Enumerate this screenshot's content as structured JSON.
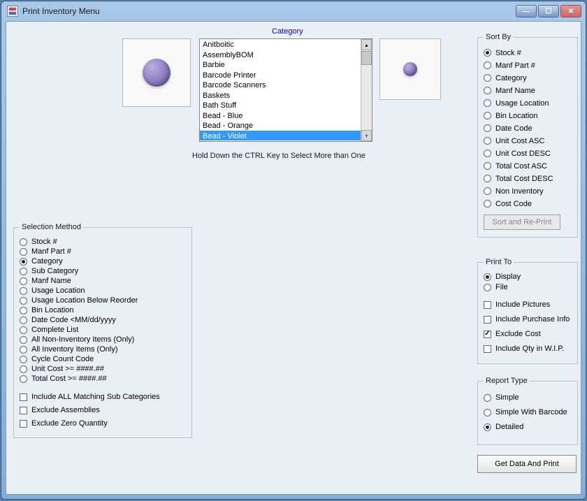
{
  "window": {
    "title": "Print Inventory Menu"
  },
  "category": {
    "label": "Category",
    "hint": "Hold Down the CTRL Key to Select More than One",
    "items": [
      "Anitboitic",
      "AssemblyBOM",
      "Barbie",
      "Barcode Printer",
      "Barcode Scanners",
      "Baskets",
      "Bath Stuff",
      "Bead - Blue",
      "Bead - Orange",
      "Bead - Violet"
    ],
    "selected_index": 9
  },
  "selection_method": {
    "legend": "Selection Method",
    "options": [
      "Stock #",
      "Manf Part #",
      "Category",
      "Sub Category",
      "Manf Name",
      "Usage Location",
      "Usage Location Below Reorder",
      "Bin Location",
      "Date Code <MM/dd/yyyy",
      "Complete List",
      "All Non-Inventory Items (Only)",
      "All Inventory Items (Only)",
      "Cycle Count Code",
      "Unit Cost   >= ####.##",
      "Total Cost >= ####.##"
    ],
    "selected_index": 2,
    "checks": [
      {
        "label": "Include ALL Matching Sub Categories",
        "checked": false
      },
      {
        "label": "Exclude Assemblies",
        "checked": false
      },
      {
        "label": "Exclude Zero Quantity",
        "checked": false
      }
    ]
  },
  "sort_by": {
    "legend": "Sort By",
    "options": [
      "Stock #",
      "Manf Part #",
      "Category",
      "Manf Name",
      "Usage Location",
      "Bin Location",
      "Date Code",
      "Unit Cost ASC",
      "Unit Cost DESC",
      "Total Cost ASC",
      "Total Cost DESC",
      "Non Inventory",
      "Cost Code"
    ],
    "selected_index": 0,
    "button": "Sort and Re-Print"
  },
  "print_to": {
    "legend": "Print To",
    "options": [
      "Display",
      "File"
    ],
    "selected_index": 0,
    "checks": [
      {
        "label": "Include Pictures",
        "checked": false
      },
      {
        "label": "Include Purchase Info",
        "checked": false
      },
      {
        "label": "Exclude Cost",
        "checked": true
      },
      {
        "label": "Include Qty in W.I.P.",
        "checked": false
      }
    ]
  },
  "report_type": {
    "legend": "Report Type",
    "options": [
      "Simple",
      "Simple With Barcode",
      "Detailed"
    ],
    "selected_index": 2
  },
  "buttons": {
    "get_data": "Get Data And Print"
  }
}
